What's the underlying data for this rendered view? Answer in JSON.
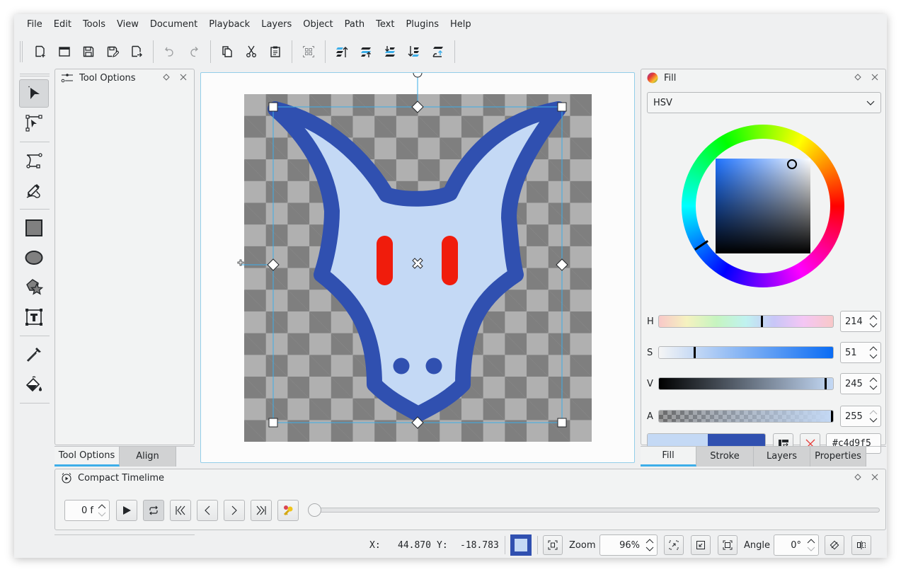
{
  "menubar": {
    "items": [
      "File",
      "Edit",
      "Tools",
      "View",
      "Document",
      "Playback",
      "Layers",
      "Object",
      "Path",
      "Text",
      "Plugins",
      "Help"
    ]
  },
  "toolbar": {
    "buttons": [
      {
        "name": "new-document",
        "icon": "new-file-icon"
      },
      {
        "name": "open",
        "icon": "folder-icon"
      },
      {
        "name": "save",
        "icon": "save-icon"
      },
      {
        "name": "save-as",
        "icon": "save-as-icon"
      },
      {
        "name": "export",
        "icon": "export-icon"
      },
      {
        "name": "undo",
        "icon": "undo-icon"
      },
      {
        "name": "redo",
        "icon": "redo-icon"
      },
      {
        "name": "copy",
        "icon": "copy-icon"
      },
      {
        "name": "cut",
        "icon": "scissors-icon"
      },
      {
        "name": "paste",
        "icon": "paste-icon"
      },
      {
        "name": "group",
        "icon": "group-icon"
      },
      {
        "name": "raise-to-top",
        "icon": "raise-top-icon"
      },
      {
        "name": "raise",
        "icon": "raise-icon"
      },
      {
        "name": "lower",
        "icon": "lower-icon"
      },
      {
        "name": "lower-to-bottom",
        "icon": "lower-bottom-icon"
      },
      {
        "name": "move-to-layer",
        "icon": "move-layer-icon"
      }
    ]
  },
  "tools": [
    {
      "name": "select",
      "icon": "arrow-pointer-icon",
      "active": true
    },
    {
      "name": "edit-nodes",
      "icon": "node-edit-icon",
      "active": false
    },
    {
      "name": "bezier",
      "icon": "bezier-icon",
      "active": false
    },
    {
      "name": "freehand",
      "icon": "pencil-draw-icon",
      "active": false
    },
    {
      "name": "rectangle",
      "icon": "rectangle-icon",
      "active": false
    },
    {
      "name": "ellipse",
      "icon": "ellipse-icon",
      "active": false
    },
    {
      "name": "polygon-star",
      "icon": "polygon-star-icon",
      "active": false
    },
    {
      "name": "text",
      "icon": "text-box-icon",
      "active": false
    },
    {
      "name": "color-picker",
      "icon": "eyedropper-icon",
      "active": false
    },
    {
      "name": "fill",
      "icon": "paint-bucket-icon",
      "active": false
    }
  ],
  "tool_options_dock": {
    "title": "Tool Options",
    "tabs": [
      {
        "label": "Tool Options",
        "active": true
      },
      {
        "label": "Align",
        "active": false
      }
    ]
  },
  "fill_dock": {
    "title": "Fill",
    "mode": "HSV",
    "sliders": [
      {
        "label": "H",
        "value": "214",
        "fraction": 0.594
      },
      {
        "label": "S",
        "value": "51",
        "fraction": 0.2
      },
      {
        "label": "V",
        "value": "245",
        "fraction": 0.961
      },
      {
        "label": "A",
        "value": "255",
        "fraction": 1.0
      }
    ],
    "current_color": "#c4d9f5",
    "secondary_color": "#3050b0",
    "hex_value": "#c4d9f5",
    "tabs": [
      {
        "label": "Fill",
        "active": true
      },
      {
        "label": "Stroke",
        "active": false
      },
      {
        "label": "Layers",
        "active": false
      },
      {
        "label": "Properties",
        "active": false
      }
    ]
  },
  "timeline": {
    "title": "Compact Timelime",
    "frame_value": "0 f",
    "position_fraction": 0.0
  },
  "status": {
    "x_label": "X:",
    "x_value": "44.870",
    "y_label": "Y:",
    "y_value": "-18.783",
    "zoom_label": "Zoom",
    "zoom_value": "96%",
    "angle_label": "Angle",
    "angle_value": "0°"
  },
  "colors": {
    "accent": "#3daee9",
    "shape_fill": "#c4d9f5",
    "shape_stroke": "#3050b0",
    "eyes": "#f01c0c"
  }
}
